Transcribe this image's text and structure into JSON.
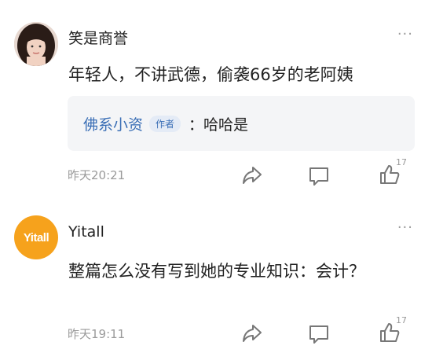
{
  "comments": [
    {
      "user": "笑是商誉",
      "text": "年轻人，不讲武德，偷袭66岁的老阿姨",
      "reply": {
        "user": "佛系小资",
        "tag": "作者",
        "text": "：哈哈是"
      },
      "time": "昨天20:21",
      "likes": "17",
      "more": "···"
    },
    {
      "user": "Yitall",
      "avatar_text": "Yitall",
      "text": "整篇怎么没有写到她的专业知识：会计？",
      "time": "昨天19:11",
      "likes": "17",
      "more": "···"
    }
  ]
}
